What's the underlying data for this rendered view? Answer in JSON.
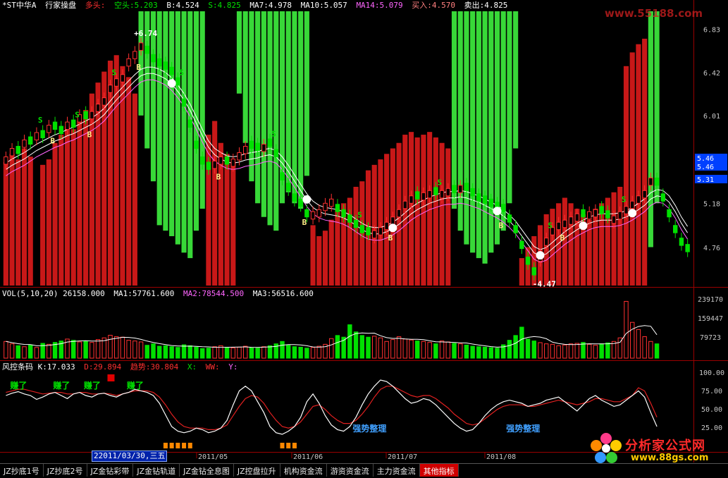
{
  "header": {
    "symbol": "*ST中华A",
    "subtitle": "行家操盘",
    "long_label": "多头:",
    "short_label": "空头:5.203",
    "b_value": "B:4.524",
    "s_value": "S:4.825",
    "ma7": "MA7:4.978",
    "ma10": "MA10:5.057",
    "ma14": "MA14:5.079",
    "buy": "买入:4.570",
    "sell": "卖出:4.825"
  },
  "vol_header": {
    "vol": "VOL(5,10,20) 26158.000",
    "ma1": "MA1:57761.600",
    "ma2": "MA2:78544.500",
    "ma3": "MA3:56516.600"
  },
  "ind_header": {
    "name": "风控条码 K:17.033",
    "d": "D:29.894",
    "trend": "趋势:30.804",
    "x": "X:",
    "ww": "WW:",
    "y": "Y:"
  },
  "price_axis": [
    "6.83",
    "6.42",
    "6.01",
    "5.59",
    "5.18",
    "4.76"
  ],
  "price_boxes": [
    "5.46",
    "5.46",
    "5.31"
  ],
  "vol_axis": [
    "239170",
    "159447",
    "79723"
  ],
  "ind_axis": [
    "100.00",
    "75.00",
    "50.00",
    "25.00"
  ],
  "x_axis_labels": [
    "2011/05",
    "2011/06",
    "2011/07",
    "2011/08"
  ],
  "date_tip": "22011/03/30,三五",
  "price_annotations": {
    "high": "6.74",
    "low": "4.47",
    "buy_mark": "B",
    "sell_mark": "S"
  },
  "indicator_labels": {
    "earned": "赚了",
    "consolidation": "强势整理"
  },
  "tabs": [
    "JZ抄底1号",
    "JZ抄底2号",
    "JZ金钻彩带",
    "JZ金钻轨道",
    "JZ金钻全息图",
    "JZ控盘拉升",
    "机构资金流",
    "游资资金流",
    "主力资金流",
    "其他指标"
  ],
  "active_tab": 9,
  "watermark": "www.55188.com",
  "logo": {
    "title": "分析家公式网",
    "url": "www.88gs.com"
  },
  "colors": {
    "up": "#ff3030",
    "down": "#00e000",
    "red_bar": "#c81818",
    "green_bar": "#38d838",
    "ma_white": "#ffffff",
    "ma_magenta": "#ff66ff",
    "k_line": "#ffffff",
    "d_line": "#e02020",
    "axis_text": "#c8c8c8",
    "highlight_blue": "#0040ff"
  },
  "chart_data": {
    "type": "candlestick",
    "ylim": [
      4.4,
      7.0
    ],
    "close": [
      5.62,
      5.7,
      5.65,
      5.78,
      5.74,
      5.85,
      5.8,
      5.92,
      5.88,
      5.84,
      5.95,
      5.9,
      6.02,
      5.98,
      6.05,
      6.12,
      6.18,
      6.3,
      6.36,
      6.4,
      6.55,
      6.62,
      6.7,
      6.6,
      6.52,
      6.48,
      6.45,
      6.4,
      6.3,
      6.1,
      5.9,
      5.7,
      5.55,
      5.5,
      5.58,
      5.62,
      5.55,
      5.6,
      5.66,
      5.72,
      5.7,
      5.68,
      5.74,
      5.72,
      5.62,
      5.4,
      5.3,
      5.2,
      5.15,
      5.05,
      5.1,
      5.12,
      5.18,
      5.22,
      5.1,
      5.05,
      5.0,
      4.95,
      4.9,
      4.88,
      4.92,
      4.95,
      5.0,
      5.05,
      5.12,
      5.2,
      5.25,
      5.22,
      5.28,
      5.3,
      5.26,
      5.3,
      5.32,
      5.28,
      5.35,
      5.3,
      5.25,
      5.2,
      5.18,
      5.15,
      5.12,
      5.1,
      5.0,
      4.9,
      4.75,
      4.6,
      4.5,
      4.7,
      4.85,
      4.95,
      5.0,
      5.02,
      5.05,
      5.08,
      5.05,
      5.1,
      5.12,
      5.08,
      5.04,
      5.06,
      5.1,
      5.15,
      5.2,
      5.25,
      5.3,
      5.42,
      5.35,
      5.2,
      5.05,
      4.9,
      4.78,
      4.72
    ],
    "up_flags": [
      1,
      1,
      0,
      1,
      0,
      1,
      0,
      1,
      0,
      0,
      1,
      0,
      1,
      0,
      1,
      1,
      1,
      1,
      1,
      1,
      1,
      1,
      1,
      0,
      0,
      0,
      0,
      0,
      0,
      0,
      0,
      0,
      0,
      0,
      1,
      1,
      0,
      1,
      1,
      1,
      0,
      0,
      1,
      0,
      0,
      0,
      0,
      0,
      0,
      0,
      1,
      1,
      1,
      1,
      0,
      0,
      0,
      0,
      0,
      0,
      1,
      1,
      1,
      1,
      1,
      1,
      1,
      0,
      1,
      1,
      0,
      1,
      1,
      0,
      1,
      0,
      0,
      0,
      0,
      0,
      0,
      0,
      0,
      0,
      0,
      0,
      0,
      1,
      1,
      1,
      1,
      1,
      1,
      1,
      0,
      1,
      1,
      0,
      0,
      1,
      1,
      1,
      1,
      1,
      1,
      1,
      0,
      0,
      0,
      0,
      0,
      0
    ],
    "buy_sell_bars": [
      1,
      1,
      1,
      1,
      1,
      0,
      1,
      1,
      1,
      1,
      1,
      1,
      1,
      1,
      1,
      1,
      1,
      1,
      1,
      1,
      1,
      1,
      -1,
      -1,
      -1,
      -1,
      -1,
      -1,
      -1,
      -1,
      -1,
      -1,
      -1,
      1,
      1,
      1,
      1,
      1,
      -1,
      -1,
      -1,
      -1,
      -1,
      -1,
      -1,
      -1,
      -1,
      -1,
      -1,
      -1,
      1,
      1,
      1,
      1,
      1,
      1,
      1,
      1,
      1,
      1,
      1,
      1,
      1,
      1,
      1,
      1,
      1,
      1,
      1,
      1,
      1,
      1,
      1,
      -1,
      -1,
      -1,
      -1,
      -1,
      -1,
      -1,
      -1,
      -1,
      -1,
      -1,
      1,
      1,
      1,
      1,
      1,
      1,
      1,
      1,
      1,
      1,
      1,
      1,
      1,
      1,
      1,
      1,
      1,
      1,
      1,
      1,
      1,
      -1,
      -1,
      -1,
      -1,
      -1,
      -1
    ],
    "bar_level": [
      0.45,
      0.48,
      0.46,
      0.5,
      0.47,
      0.0,
      0.44,
      0.46,
      0.52,
      0.55,
      0.58,
      0.57,
      0.6,
      0.64,
      0.7,
      0.74,
      0.78,
      0.82,
      0.84,
      0.8,
      0.76,
      0.7,
      0.38,
      0.5,
      0.62,
      0.78,
      0.8,
      0.82,
      0.85,
      0.88,
      0.9,
      0.8,
      0.72,
      0.55,
      0.6,
      0.52,
      0.48,
      0.45,
      0.3,
      0.48,
      0.62,
      0.7,
      0.75,
      0.78,
      0.8,
      0.7,
      0.66,
      0.7,
      0.72,
      0.6,
      0.22,
      0.18,
      0.2,
      0.24,
      0.28,
      0.3,
      0.32,
      0.36,
      0.38,
      0.42,
      0.44,
      0.46,
      0.48,
      0.5,
      0.52,
      0.55,
      0.56,
      0.54,
      0.55,
      0.56,
      0.54,
      0.52,
      0.5,
      0.72,
      0.8,
      0.85,
      0.88,
      0.9,
      0.92,
      0.88,
      0.85,
      0.8,
      0.7,
      0.5,
      0.1,
      0.14,
      0.18,
      0.22,
      0.26,
      0.28,
      0.3,
      0.32,
      0.3,
      0.28,
      0.26,
      0.24,
      0.28,
      0.3,
      0.32,
      0.34,
      0.36,
      0.8,
      0.85,
      0.88,
      0.9,
      0.86,
      0.7
    ],
    "volume": [
      70000,
      60000,
      52000,
      48000,
      55000,
      45000,
      62000,
      58000,
      66000,
      72000,
      80000,
      75000,
      68000,
      70000,
      66000,
      78000,
      85000,
      96000,
      90000,
      88000,
      75000,
      72000,
      68000,
      54000,
      60000,
      50000,
      52000,
      48000,
      45000,
      56000,
      52000,
      46000,
      40000,
      42000,
      48000,
      52000,
      45000,
      43000,
      46000,
      50000,
      44000,
      42000,
      48000,
      52000,
      60000,
      70000,
      54000,
      48000,
      46000,
      42000,
      45000,
      50000,
      58000,
      82000,
      95000,
      88000,
      140000,
      110000,
      95000,
      88000,
      92000,
      85000,
      70000,
      78000,
      90000,
      80000,
      76000,
      72000,
      70000,
      66000,
      60000,
      72000,
      68000,
      62000,
      60000,
      55000,
      50000,
      48000,
      46000,
      44000,
      42000,
      56000,
      75000,
      95000,
      130000,
      80000,
      72000,
      65000,
      60000,
      58000,
      52000,
      55000,
      60000,
      62000,
      66000,
      58000,
      54000,
      60000,
      64000,
      70000,
      85000,
      238000,
      150000,
      120000,
      90000,
      70000,
      60000
    ],
    "k": [
      70,
      73,
      75,
      72,
      70,
      65,
      68,
      72,
      74,
      70,
      66,
      72,
      74,
      70,
      68,
      72,
      73,
      70,
      68,
      72,
      74,
      78,
      76,
      74,
      70,
      60,
      45,
      30,
      24,
      22,
      24,
      28,
      26,
      22,
      24,
      28,
      38,
      58,
      76,
      82,
      76,
      62,
      48,
      30,
      22,
      20,
      24,
      30,
      42,
      62,
      72,
      60,
      44,
      32,
      26,
      24,
      30,
      42,
      58,
      72,
      82,
      90,
      88,
      82,
      74,
      66,
      60,
      62,
      66,
      64,
      58,
      50,
      42,
      34,
      28,
      24,
      26,
      34,
      44,
      52,
      58,
      62,
      64,
      62,
      60,
      56,
      58,
      60,
      64,
      66,
      68,
      62,
      56,
      50,
      58,
      66,
      70,
      64,
      60,
      56,
      58,
      64,
      70,
      76,
      68,
      48,
      30
    ],
    "d": [
      74,
      76,
      78,
      78,
      76,
      74,
      72,
      73,
      74,
      74,
      72,
      72,
      74,
      74,
      72,
      72,
      73,
      72,
      70,
      72,
      74,
      76,
      76,
      76,
      74,
      68,
      58,
      46,
      36,
      30,
      28,
      28,
      28,
      26,
      26,
      28,
      32,
      44,
      56,
      66,
      70,
      68,
      60,
      48,
      38,
      30,
      28,
      30,
      36,
      46,
      56,
      58,
      52,
      44,
      38,
      34,
      34,
      38,
      46,
      56,
      68,
      78,
      82,
      82,
      78,
      74,
      70,
      68,
      70,
      70,
      66,
      60,
      54,
      46,
      40,
      34,
      32,
      34,
      40,
      46,
      52,
      56,
      58,
      58,
      58,
      56,
      56,
      58,
      60,
      62,
      64,
      62,
      60,
      58,
      60,
      62,
      66,
      66,
      64,
      62,
      62,
      66,
      70,
      80,
      76,
      60,
      42
    ],
    "ma_fast": [
      5.56,
      5.6,
      5.63,
      5.66,
      5.7,
      5.74,
      5.77,
      5.8,
      5.83,
      5.85,
      5.88,
      5.9,
      5.93,
      5.96,
      5.99,
      6.03,
      6.08,
      6.15,
      6.22,
      6.28,
      6.34,
      6.4,
      6.45,
      6.47,
      6.47,
      6.45,
      6.42,
      6.37,
      6.3,
      6.22,
      6.12,
      6.0,
      5.88,
      5.77,
      5.7,
      5.66,
      5.63,
      5.62,
      5.63,
      5.65,
      5.66,
      5.67,
      5.69,
      5.7,
      5.68,
      5.62,
      5.54,
      5.45,
      5.36,
      5.27,
      5.2,
      5.16,
      5.14,
      5.13,
      5.12,
      5.1,
      5.07,
      5.03,
      4.99,
      4.96,
      4.95,
      4.95,
      4.97,
      5.0,
      5.04,
      5.09,
      5.14,
      5.18,
      5.21,
      5.24,
      5.26,
      5.28,
      5.29,
      5.29,
      5.3,
      5.29,
      5.27,
      5.25,
      5.22,
      5.19,
      5.16,
      5.12,
      5.07,
      5.01,
      4.93,
      4.85,
      4.77,
      4.74,
      4.76,
      4.81,
      4.86,
      4.91,
      4.95,
      4.99,
      5.02,
      5.05,
      5.07,
      5.08,
      5.08,
      5.08,
      5.09,
      5.11,
      5.14,
      5.18,
      5.22,
      5.28,
      5.31,
      5.3,
      5.25,
      5.16,
      5.05,
      4.96
    ]
  }
}
